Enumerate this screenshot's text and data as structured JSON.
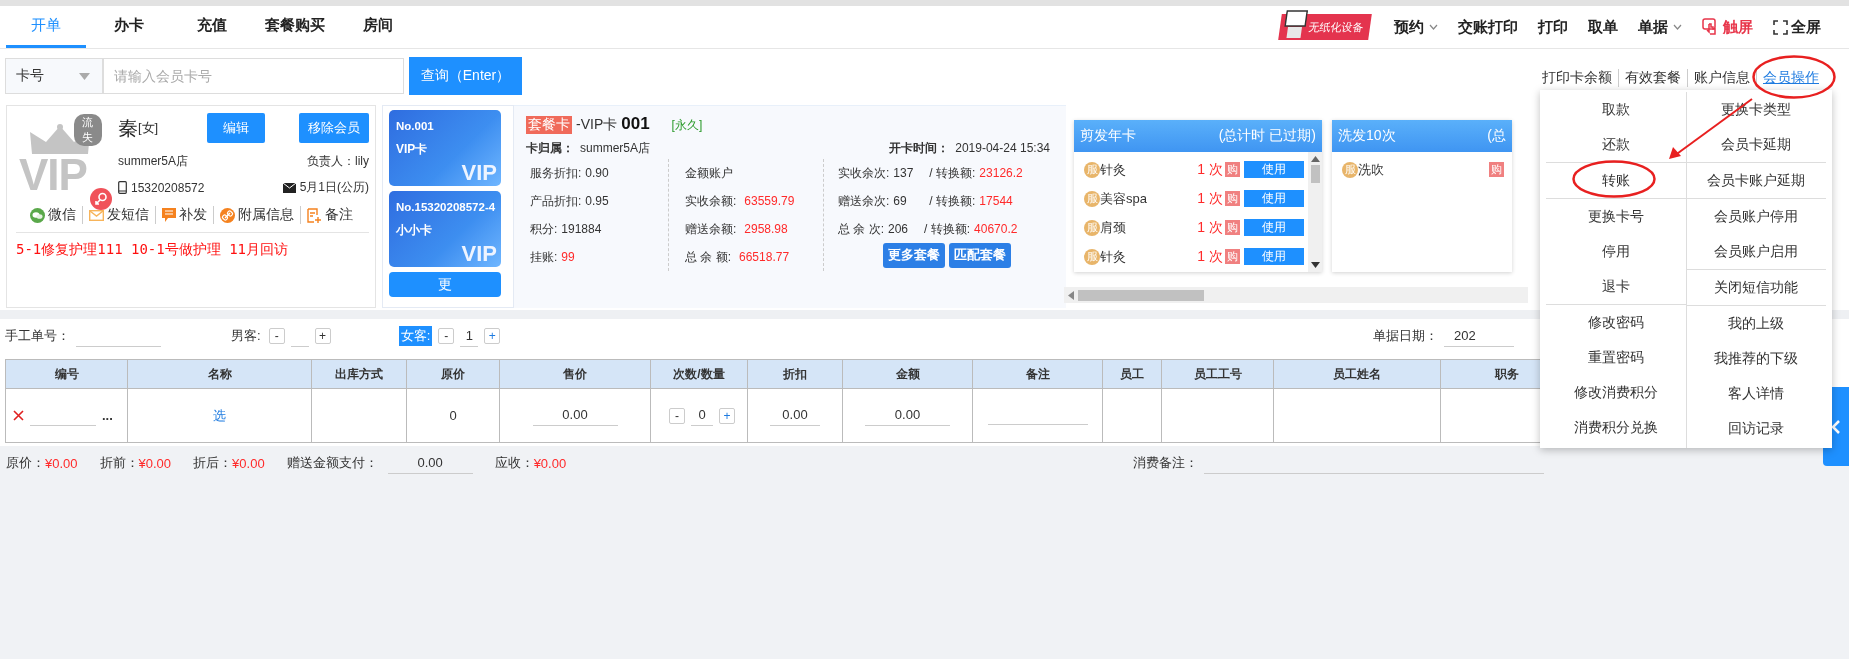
{
  "top_nav": {
    "tabs": [
      {
        "label": "开单",
        "selected": true
      },
      {
        "label": "办卡",
        "selected": false
      },
      {
        "label": "充值",
        "selected": false
      },
      {
        "label": "套餐购买",
        "selected": false
      },
      {
        "label": "房间",
        "selected": false
      }
    ],
    "device_badge": "无纸化设备",
    "actions": [
      {
        "label": "预约",
        "kind": "dropdown"
      },
      {
        "label": "交账打印",
        "kind": "plain"
      },
      {
        "label": "打印",
        "kind": "plain"
      },
      {
        "label": "取单",
        "kind": "plain"
      },
      {
        "label": "单据",
        "kind": "dropdown"
      },
      {
        "label": "触屏",
        "kind": "touch"
      },
      {
        "label": "全屏",
        "kind": "fullscreen"
      }
    ]
  },
  "search": {
    "type_select": "卡号",
    "placeholder": "请输入会员卡号",
    "button": "查询（Enter）"
  },
  "member_links": [
    {
      "label": "打印卡余额",
      "kind": "plain"
    },
    {
      "label": "有效套餐",
      "kind": "plain"
    },
    {
      "label": "账户信息",
      "kind": "plain"
    },
    {
      "label": "会员操作",
      "kind": "link"
    }
  ],
  "member": {
    "avatar_text": "VIP",
    "status_badge": "流失",
    "name": "秦",
    "gender": "[女]",
    "edit_button": "编辑",
    "remove_button": "移除会员",
    "store": "summer5A店",
    "manager": "负责人：lily",
    "phone": "15320208572",
    "birthday": "5月1日(公历)",
    "actions": [
      {
        "label": "微信",
        "kind": "wechat"
      },
      {
        "label": "发短信",
        "kind": "sms"
      },
      {
        "label": "补发",
        "kind": "resend"
      },
      {
        "label": "附属信息",
        "kind": "attach"
      },
      {
        "label": "备注",
        "kind": "note"
      }
    ],
    "notes": "5-1修复护理111 10-1号做护理 11月回访"
  },
  "cards": {
    "items": [
      {
        "number": "No.001",
        "name": "VIP卡",
        "mark": "VIP"
      },
      {
        "number": "No.15320208572-4",
        "name": "小小卡",
        "mark": "VIP"
      }
    ],
    "more_button": "更"
  },
  "card_info": {
    "type_tag": "套餐卡",
    "card_type": "-VIP卡",
    "card_no": "001",
    "validity": "[永久]",
    "owner_label": "卡归属：",
    "owner": "summer5A店",
    "open_label": "开卡时间：",
    "open_time": "2019-04-24 15:34",
    "columns": [
      [
        {
          "label": "服务折扣:",
          "value": "0.90",
          "alert": false
        },
        {
          "label": "产品折扣:",
          "value": "0.95",
          "alert": false
        },
        {
          "label": "积分:",
          "value": "191884",
          "alert": false
        },
        {
          "label": "挂账:",
          "value": "99",
          "alert": true
        }
      ],
      [
        {
          "label": "金额账户"
        },
        {
          "label": "实收余额:",
          "value": "63559.79",
          "alert": true
        },
        {
          "label": "赠送余额:",
          "value": "2958.98",
          "alert": true
        },
        {
          "label": "总 余 额:",
          "value": "66518.77",
          "alert": true
        }
      ],
      [
        {
          "label": "实收余次:",
          "value": "137",
          "extra_label": "/ 转换额:",
          "extra_value": "23126.2",
          "alert": true
        },
        {
          "label": "赠送余次:",
          "value": "69",
          "extra_label": "/ 转换额:",
          "extra_value": "17544",
          "alert": true
        },
        {
          "label": "总 余 次:",
          "value": "206",
          "extra_label": "/ 转换额:",
          "extra_value": "40670.2",
          "alert": true
        }
      ]
    ],
    "buttons": [
      "更多套餐",
      "匹配套餐"
    ]
  },
  "packages": [
    {
      "title": "剪发年卡",
      "status": "(总计时 已过期)",
      "items": [
        {
          "badge": "服",
          "name": "针灸",
          "count": "1 次",
          "buy": "购",
          "use": "使用"
        },
        {
          "badge": "服",
          "name": "美容spa",
          "count": "1 次",
          "buy": "购",
          "use": "使用"
        },
        {
          "badge": "服",
          "name": "肩颈",
          "count": "1 次",
          "buy": "购",
          "use": "使用"
        },
        {
          "badge": "服",
          "name": "针灸",
          "count": "1 次",
          "buy": "购",
          "use": "使用"
        }
      ]
    },
    {
      "title": "洗发10次",
      "status": "(总",
      "items": [
        {
          "badge": "服",
          "name": "洗吹",
          "buy": "购"
        }
      ]
    }
  ],
  "order": {
    "manual_no_label": "手工单号：",
    "guests": [
      {
        "label": "男客:",
        "minus": "-",
        "plus": "+",
        "selected": false
      },
      {
        "label": "女客:",
        "minus": "-",
        "value": "1",
        "plus": "+",
        "selected": true
      }
    ],
    "date_label": "单据日期：",
    "date_value": "202"
  },
  "table": {
    "columns": [
      "编号",
      "名称",
      "出库方式",
      "原价",
      "售价",
      "次数/数量",
      "折扣",
      "金额",
      "备注",
      "员工",
      "员工工号",
      "员工姓名",
      "职务"
    ],
    "rows": [
      {
        "more": "...",
        "name": "选",
        "origin_price": "0",
        "price": "0.00",
        "qty_minus": "-",
        "qty": "0",
        "qty_plus": "+",
        "discount": "0.00",
        "amount": "0.00"
      }
    ]
  },
  "totals": [
    {
      "label": "原价：",
      "value": "¥0.00"
    },
    {
      "label": "折前：",
      "value": "¥0.00"
    },
    {
      "label": "折后：",
      "value": "¥0.00"
    }
  ],
  "gift_payment": {
    "label": "赠送金额支付：",
    "value": "0.00"
  },
  "receivable": {
    "label": "应收：",
    "value": "¥0.00"
  },
  "remark_label": "消费备注：",
  "member_menu": {
    "columns": [
      [
        [
          "取款",
          "还款"
        ],
        [
          "转账"
        ],
        [
          "更换卡号",
          "停用",
          "退卡"
        ],
        [
          "修改密码",
          "重置密码",
          "修改消费积分",
          "消费积分兑换"
        ]
      ],
      [
        [
          "更换卡类型",
          "会员卡延期"
        ],
        [
          "会员卡账户延期"
        ],
        [
          "会员账户停用",
          "会员账户启用"
        ],
        [
          "关闭短信功能"
        ],
        [
          "我的上级",
          "我推荐的下级",
          "客人详情",
          "回访记录"
        ]
      ]
    ]
  }
}
